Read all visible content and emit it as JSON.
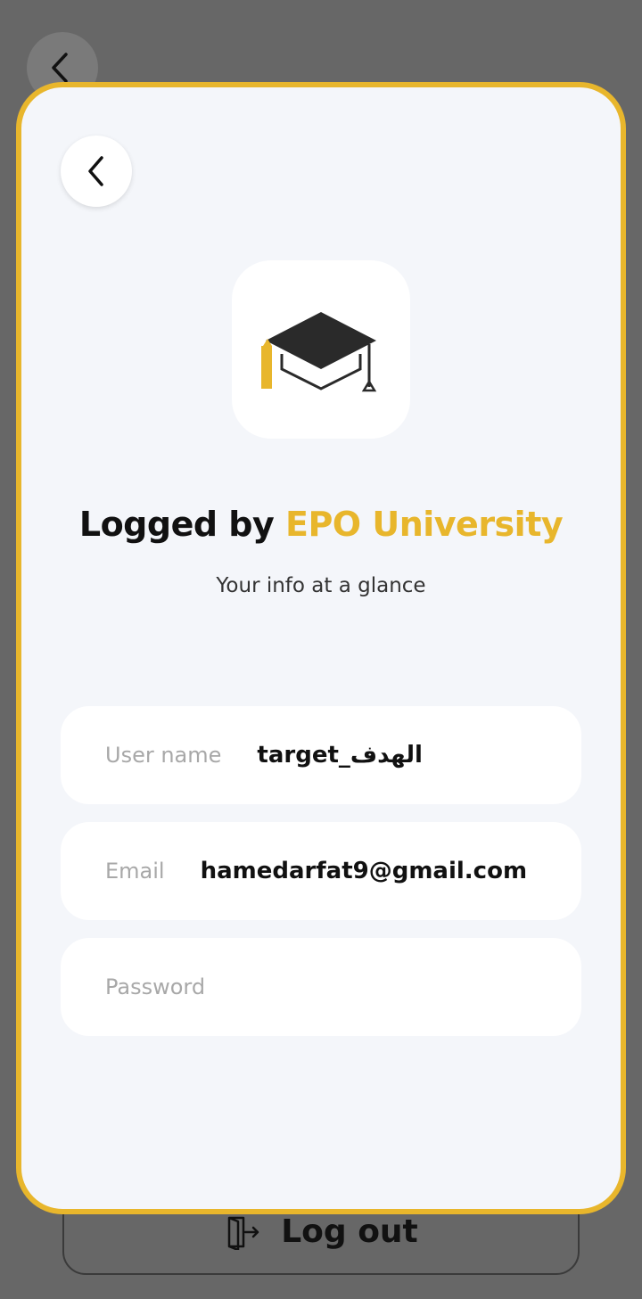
{
  "background": {
    "logout_label": "Log out"
  },
  "card": {
    "title_prefix": "Logged by ",
    "title_accent": "EPO University",
    "subtitle": "Your info at a glance",
    "fields": [
      {
        "label": "User name",
        "value": "target_الهدف"
      },
      {
        "label": "Email",
        "value": "hamedarfat9@gmail.com"
      },
      {
        "label": "Password",
        "value": ""
      }
    ]
  },
  "icons": {
    "back": "chevron-left-icon",
    "logo": "graduation-cap-icon",
    "logout": "logout-door-icon"
  },
  "colors": {
    "accent": "#e8b62c",
    "card_bg": "#f4f6fa",
    "overlay": "#676767"
  }
}
